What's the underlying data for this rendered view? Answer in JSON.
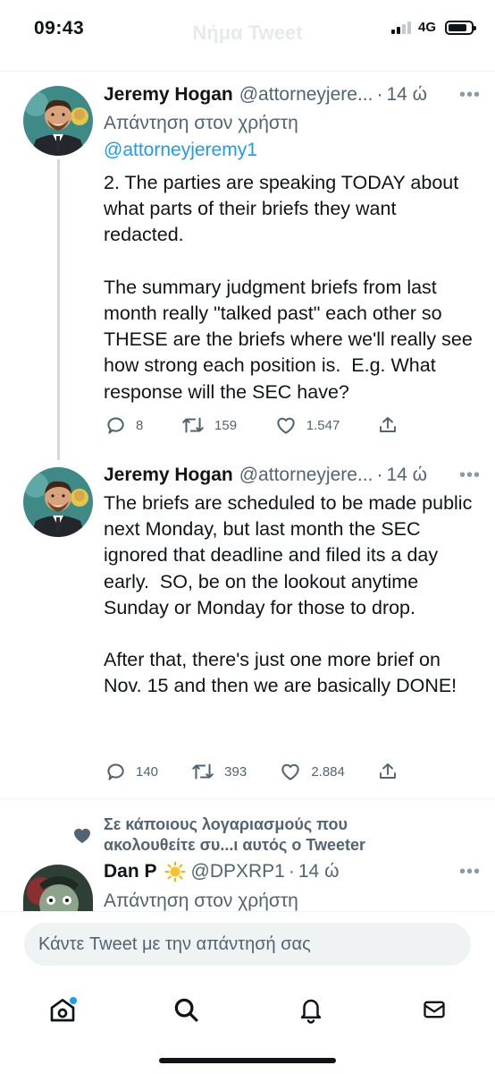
{
  "status_bar": {
    "time": "09:43",
    "network": "4G",
    "battery_level": 0.85
  },
  "header": {
    "title": "Νήμα Tweet"
  },
  "tweets": [
    {
      "author_name": "Jeremy Hogan",
      "author_handle": "@attorneyjere...",
      "dot": "·",
      "time": "14 ώ",
      "reply_label": "Απάντηση στον χρήστη",
      "reply_handle": "@attorneyjeremy1",
      "text": "2. The parties are speaking TODAY about what parts of their briefs they want redacted.\n\nThe summary judgment briefs from last month really \"talked past\" each other so THESE are the briefs where we'll really see how strong each position is.  E.g. What response will the SEC have?",
      "replies": "8",
      "retweets": "159",
      "likes": "1.547"
    },
    {
      "author_name": "Jeremy Hogan",
      "author_handle": "@attorneyjere...",
      "dot": "·",
      "time": "14 ώ",
      "text": "The briefs are scheduled to be made public next Monday, but last month the SEC ignored that deadline and filed its a day early.  SO, be on the lookout anytime Sunday or Monday for those to drop.\n\nAfter that, there's just one more brief on Nov. 15 and then we are basically DONE!",
      "replies": "140",
      "retweets": "393",
      "likes": "2.884"
    }
  ],
  "social_context": {
    "text": "Σε κάποιους λογαριασμούς που ακολουθείτε συ...ι αυτός ο Tweeter"
  },
  "next_tweet": {
    "author_name": "Dan P",
    "author_handle": "@DPXRP1",
    "dot": "·",
    "time": "14 ώ",
    "reply_label": "Απάντηση στον χρήστη"
  },
  "composer": {
    "placeholder": "Κάντε Tweet με την απάντησή σας"
  },
  "tabbar": {
    "items": [
      "home-icon",
      "search-icon",
      "notifications-icon",
      "messages-icon"
    ]
  },
  "colors": {
    "link": "#1d9bf0",
    "secondary": "#536471",
    "text": "#0f1419",
    "background": "#ffffff"
  }
}
